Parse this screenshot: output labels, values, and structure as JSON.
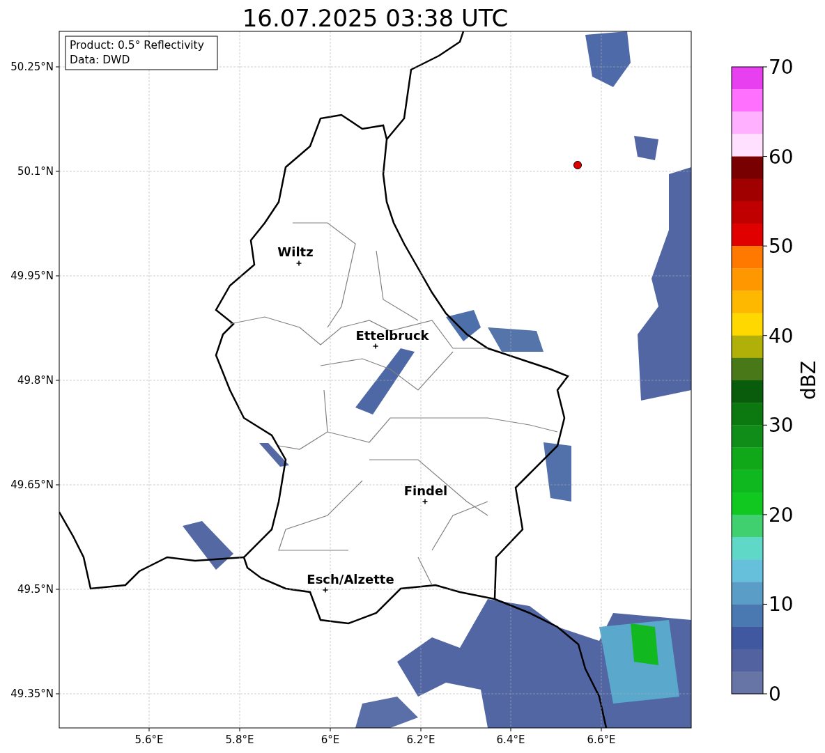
{
  "title": "16.07.2025 03:38 UTC",
  "legend": [
    "Product: 0.5° Reflectivity",
    "Data: DWD"
  ],
  "axes": {
    "xticks": [
      "5.6°E",
      "5.8°E",
      "6°E",
      "6.2°E",
      "6.4°E",
      "6.6°E"
    ],
    "yticks": [
      "50.25°N",
      "50.1°N",
      "49.95°N",
      "49.8°N",
      "49.65°N",
      "49.5°N",
      "49.35°N"
    ]
  },
  "cities": [
    {
      "name": "Wiltz"
    },
    {
      "name": "Ettelbruck"
    },
    {
      "name": "Findel"
    },
    {
      "name": "Esch/Alzette"
    }
  ],
  "colorbar": {
    "label": "dBZ",
    "ticks": [
      "70",
      "60",
      "50",
      "40",
      "30",
      "20",
      "10",
      "0"
    ],
    "bands": [
      {
        "color": "#e840f0"
      },
      {
        "color": "#ff70ff"
      },
      {
        "color": "#ffb0ff"
      },
      {
        "color": "#ffe0ff"
      },
      {
        "color": "#780000"
      },
      {
        "color": "#a00000"
      },
      {
        "color": "#c00000"
      },
      {
        "color": "#e00000"
      },
      {
        "color": "#ff7800"
      },
      {
        "color": "#ff9800"
      },
      {
        "color": "#ffb800"
      },
      {
        "color": "#ffd800"
      },
      {
        "color": "#b0b008"
      },
      {
        "color": "#487818"
      },
      {
        "color": "#085c0c"
      },
      {
        "color": "#0c7810"
      },
      {
        "color": "#108c18"
      },
      {
        "color": "#10a818"
      },
      {
        "color": "#10b820"
      },
      {
        "color": "#10c820"
      },
      {
        "color": "#40d070"
      },
      {
        "color": "#60d8c8"
      },
      {
        "color": "#66c0dc"
      },
      {
        "color": "#5a9ec8"
      },
      {
        "color": "#4a78b0"
      },
      {
        "color": "#4058a0"
      },
      {
        "color": "#52619f"
      },
      {
        "color": "#6674a6"
      }
    ]
  }
}
